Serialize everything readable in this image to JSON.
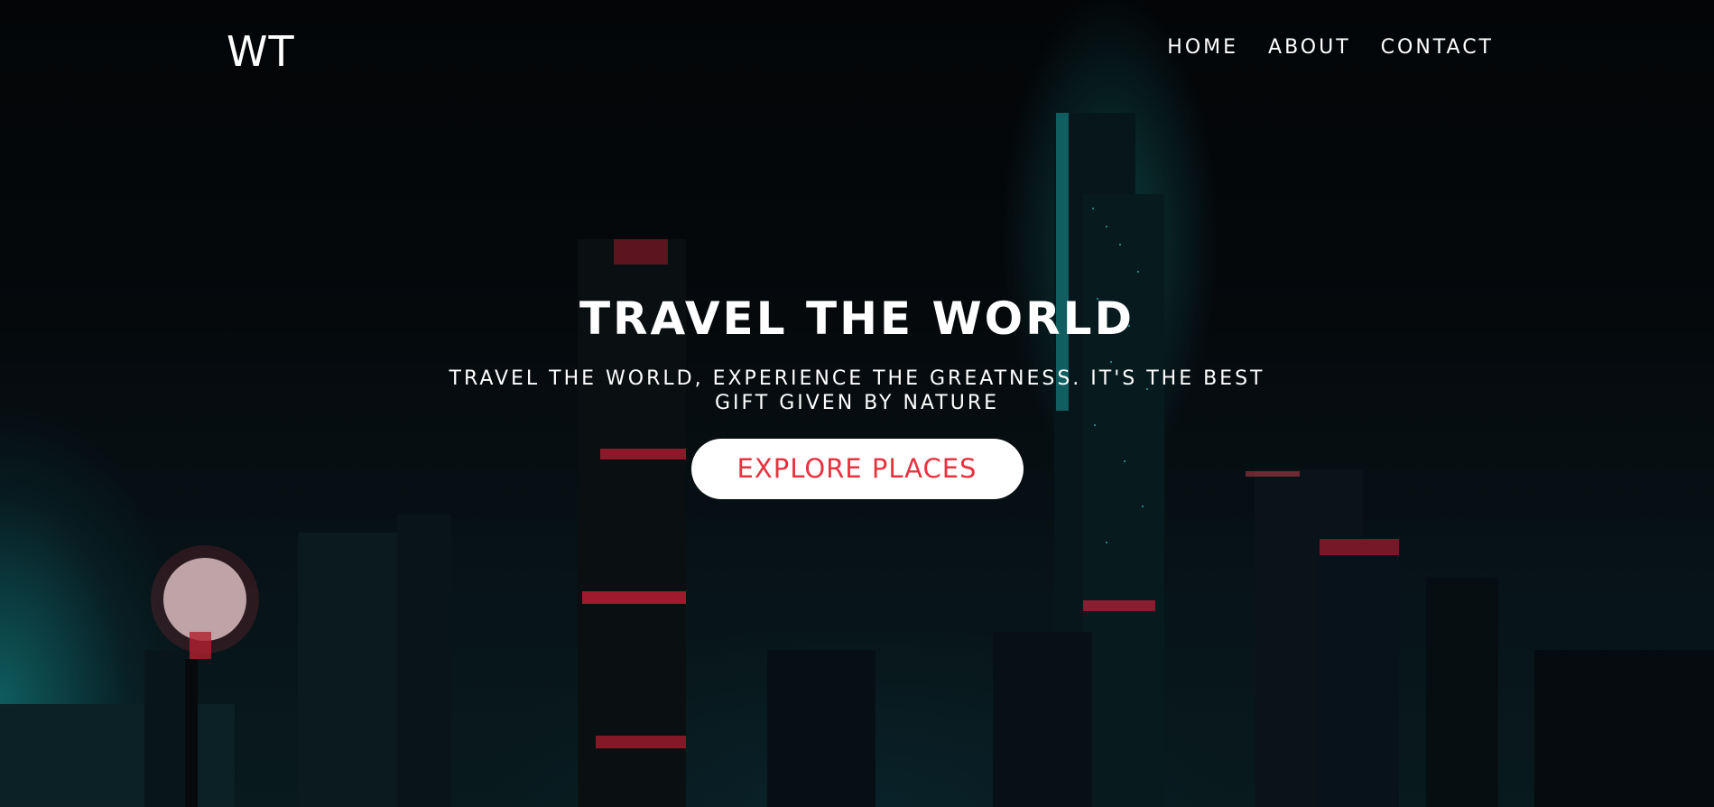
{
  "header": {
    "logo_text": "WT",
    "nav_items": [
      "HOME",
      "ABOUT",
      "CONTACT"
    ]
  },
  "hero": {
    "title": "TRAVEL THE WORLD",
    "subtitle": "TRAVEL THE WORLD, EXPERIENCE THE GREATNESS. IT'S THE BEST GIFT GIVEN BY NATURE",
    "cta_label": "EXPLORE PLACES"
  },
  "colors": {
    "accent": "#e8323f",
    "text": "#ffffff",
    "background": "#04070a",
    "neon_cyan": "#1ecfcf"
  }
}
